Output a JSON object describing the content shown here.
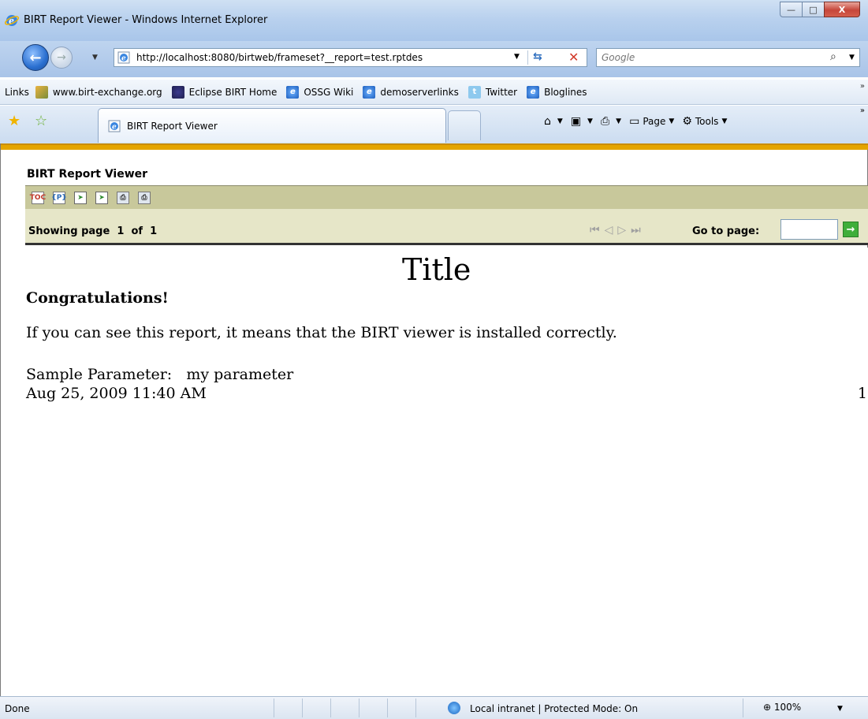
{
  "window": {
    "title": "BIRT Report Viewer - Windows Internet Explorer",
    "minimize": "—",
    "maximize": "□",
    "close": "X"
  },
  "address": {
    "url": "http://localhost:8080/birtweb/frameset?__report=test.rptdes",
    "search_placeholder": "Google"
  },
  "links_bar": {
    "label": "Links",
    "items": [
      {
        "label": "www.birt-exchange.org",
        "icon": "birt-exchange-icon"
      },
      {
        "label": "Eclipse BIRT Home",
        "icon": "eclipse-icon"
      },
      {
        "label": "OSSG Wiki",
        "icon": "ie-page-icon"
      },
      {
        "label": "demoserverlinks",
        "icon": "ie-page-icon"
      },
      {
        "label": "Twitter",
        "icon": "twitter-icon"
      },
      {
        "label": "Bloglines",
        "icon": "ie-page-icon"
      }
    ]
  },
  "tabs": {
    "active_label": "BIRT Report Viewer"
  },
  "command_bar": {
    "page_label": "Page",
    "tools_label": "Tools"
  },
  "viewer": {
    "title": "BIRT Report Viewer",
    "showing_text": "Showing page  1  of  1",
    "goto_label": "Go to page:",
    "goto_value": ""
  },
  "report": {
    "title": "Title",
    "congrats": "Congratulations!",
    "body": "If you can see this report, it means that the BIRT viewer is installed correctly.",
    "param_label": "Sample Parameter:",
    "param_value": "my parameter",
    "datetime": "Aug 25, 2009 11:40 AM",
    "page_number": "1"
  },
  "status_bar": {
    "status": "Done",
    "zone": "Local intranet | Protected Mode: On",
    "zoom": "100%"
  },
  "colors": {
    "viewer_accent": "#e4a500",
    "toolbar_bg": "#c8c89b",
    "pagebar_bg": "#e6e6c8"
  }
}
